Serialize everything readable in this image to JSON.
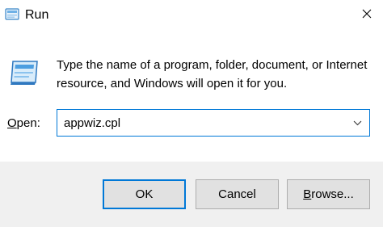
{
  "window": {
    "title": "Run",
    "icon": "run-dialog-icon",
    "close_icon": "close-icon"
  },
  "main": {
    "icon": "run-dialog-icon",
    "description": "Type the name of a program, folder, document, or Internet resource, and Windows will open it for you."
  },
  "open": {
    "label_accel": "O",
    "label_rest": "pen:",
    "value": "appwiz.cpl",
    "dropdown_icon": "chevron-down-icon"
  },
  "buttons": {
    "ok": "OK",
    "cancel": "Cancel",
    "browse_accel": "B",
    "browse_rest": "rowse..."
  },
  "colors": {
    "accent": "#0078d7",
    "footer_bg": "#f0f0f0",
    "button_bg": "#e1e1e1"
  }
}
